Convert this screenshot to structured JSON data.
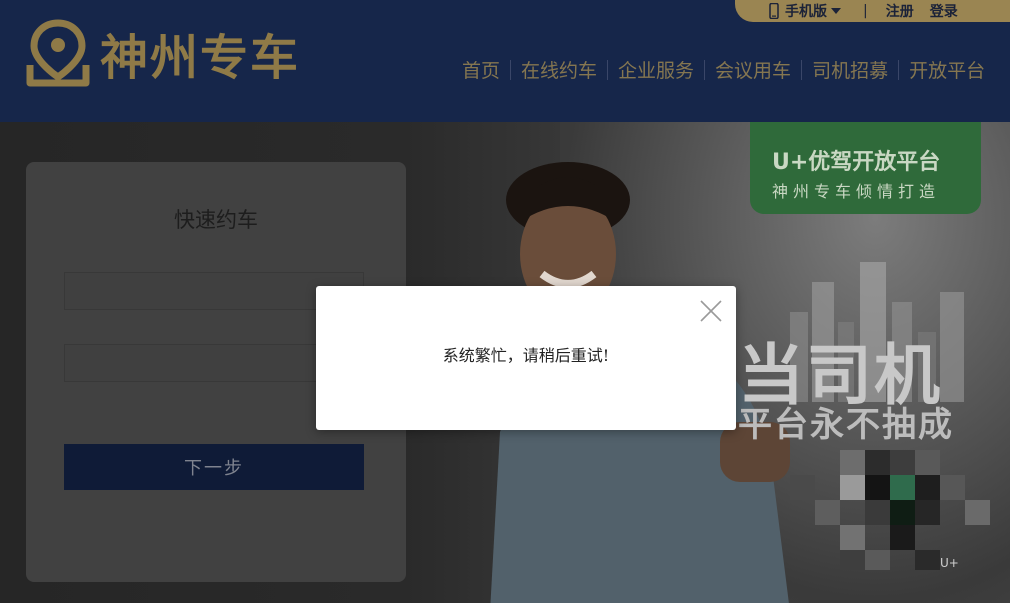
{
  "brand": {
    "name": "神州专车",
    "color": "#8f7a47"
  },
  "topbar": {
    "mobile_label": "手机版",
    "separator": "|",
    "register": "注册",
    "login": "登录"
  },
  "nav": {
    "items": [
      "首页",
      "在线约车",
      "企业服务",
      "会议用车",
      "司机招募",
      "开放平台"
    ]
  },
  "hero": {
    "badge_title": "U+优驾开放平台",
    "badge_subtitle": "神州专车倾情打造",
    "headline": "当司机",
    "subheadline": "平台永不抽成",
    "small_label": "U+"
  },
  "form": {
    "title": "快速约车",
    "phone_placeholder": "",
    "code_placeholder": "",
    "next_label": "下一步"
  },
  "modal": {
    "message": "系统繁忙，请稍后重试!",
    "close_icon": "close-icon"
  }
}
